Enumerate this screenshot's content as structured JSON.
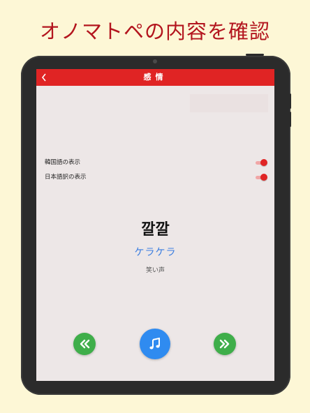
{
  "headline": "オノマトペの内容を確認",
  "appbar": {
    "back_glyph": "<",
    "title": "感情"
  },
  "settings": [
    {
      "label": "韓国語の表示",
      "enabled": true
    },
    {
      "label": "日本語訳の表示",
      "enabled": true
    }
  ],
  "word": {
    "korean": "깔깔",
    "japanese": "ケラケラ",
    "meaning": "笑い声"
  },
  "controls": {
    "prev_icon": "double-chevron-left-icon",
    "play_icon": "music-note-icon",
    "next_icon": "double-chevron-right-icon"
  },
  "colors": {
    "background": "#fdf7d6",
    "headline": "#b3151e",
    "accent_red": "#e02424",
    "green": "#3fae4a",
    "blue": "#2f8bf0",
    "japanese_text": "#3a7de0"
  }
}
